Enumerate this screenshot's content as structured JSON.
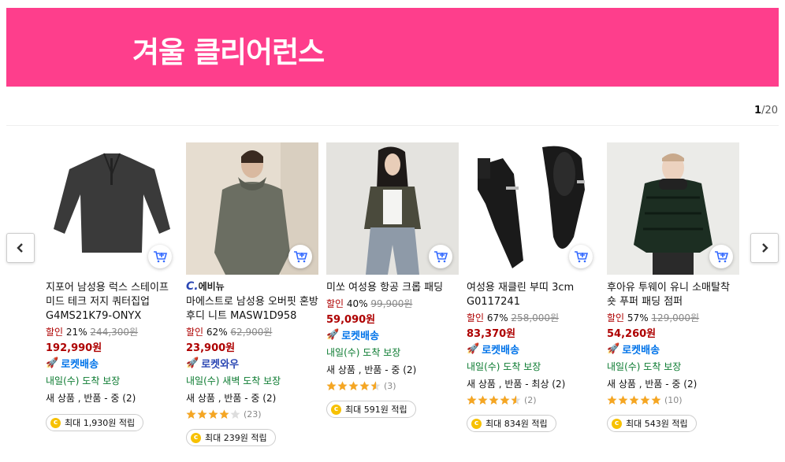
{
  "banner": {
    "title": "겨울 클리어런스",
    "color": "#fe3e8c"
  },
  "pager": {
    "current": "1",
    "total": "/20"
  },
  "products": [
    {
      "brand": "",
      "name": "지포어 남성용 럭스 스테이프 미드 테크 저지 쿼터집업 G4MS21K79-ONYX",
      "discount_label": "할인",
      "discount_rate": "21%",
      "original_price": "244,300원",
      "price": "192,990원",
      "badge": "로켓배송",
      "arrival": "내일(수) 도착 보장",
      "condition": "새 상품 , 반품 - 중 (2)",
      "rating": null,
      "review_count": "",
      "point": "최대 1,930원 적립"
    },
    {
      "brand": "C.에비뉴",
      "name": "마에스트로 남성용 오버핏 혼방 후디 니트 MASW1D958",
      "discount_label": "할인",
      "discount_rate": "62%",
      "original_price": "62,900원",
      "price": "23,900원",
      "badge": "로켓와우",
      "arrival": "내일(수) 새벽 도착 보장",
      "condition": "새 상품 , 반품 - 중 (2)",
      "rating": 4.0,
      "review_count": "(23)",
      "point": "최대 239원 적립"
    },
    {
      "brand": "",
      "name": "미쏘 여성용 항공 크롭 패딩",
      "discount_label": "할인",
      "discount_rate": "40%",
      "original_price": "99,900원",
      "price": "59,090원",
      "badge": "로켓배송",
      "arrival": "내일(수) 도착 보장",
      "condition": "새 상품 , 반품 - 중 (2)",
      "rating": 4.5,
      "review_count": "(3)",
      "point": "최대 591원 적립"
    },
    {
      "brand": "",
      "name": "여성용 재클린 부띠 3cm G0117241",
      "discount_label": "할인",
      "discount_rate": "67%",
      "original_price": "258,000원",
      "price": "83,370원",
      "badge": "로켓배송",
      "arrival": "내일(수) 도착 보장",
      "condition": "새 상품 , 반품 - 최상 (2)",
      "rating": 4.5,
      "review_count": "(2)",
      "point": "최대 834원 적립"
    },
    {
      "brand": "",
      "name": "후아유 투웨이 유니 소매탈착 숏 푸퍼 패딩 점퍼",
      "discount_label": "할인",
      "discount_rate": "57%",
      "original_price": "129,000원",
      "price": "54,260원",
      "badge": "로켓배송",
      "arrival": "내일(수) 도착 보장",
      "condition": "새 상품 , 반품 - 중 (2)",
      "rating": 5.0,
      "review_count": "(10)",
      "point": "최대 543원 적립"
    }
  ],
  "colors": {
    "price": "#ae0000",
    "rocket": "#0073e9",
    "wow": "#2a46b3",
    "arrival": "#0a7a2f",
    "star": "#f5a623"
  },
  "icons": {
    "prev": "chevron-left-icon",
    "next": "chevron-right-icon",
    "cart": "add-to-cart-icon",
    "coin": "coin-icon"
  }
}
